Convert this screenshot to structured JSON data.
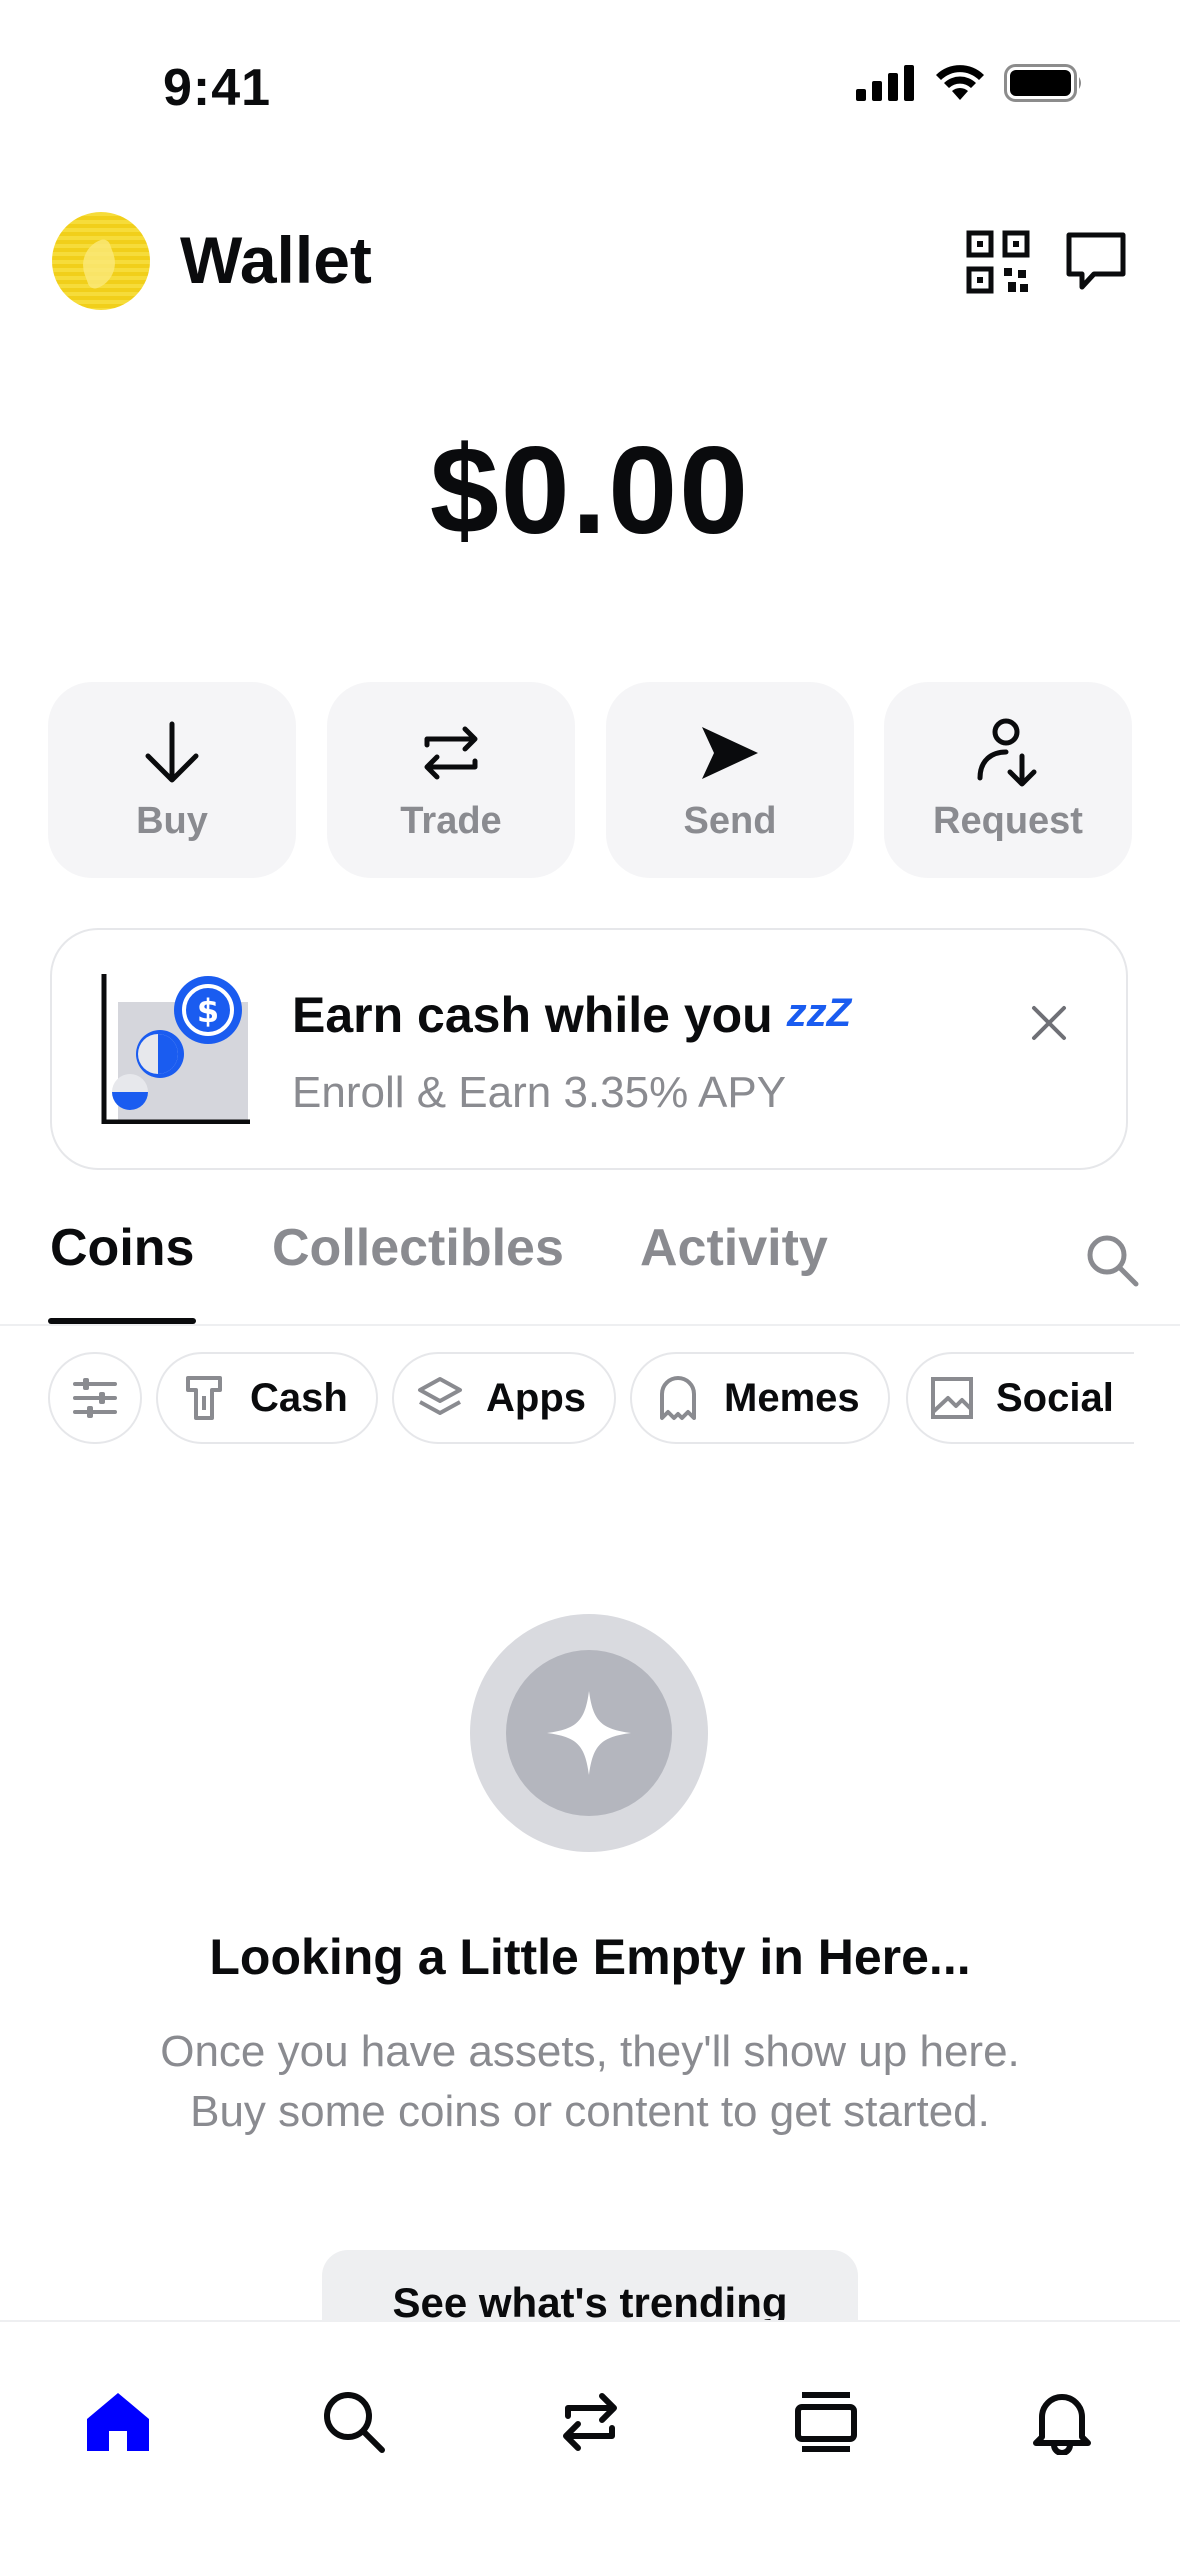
{
  "status_bar": {
    "time": "9:41",
    "icons": [
      "cellular-signal-icon",
      "wifi-icon",
      "battery-icon"
    ]
  },
  "header": {
    "title": "Wallet",
    "icons": [
      "qr-code-icon",
      "message-icon"
    ]
  },
  "balance": "$0.00",
  "actions": [
    {
      "label": "Buy",
      "icon": "arrow-down-icon"
    },
    {
      "label": "Trade",
      "icon": "swap-arrows-icon"
    },
    {
      "label": "Send",
      "icon": "send-icon"
    },
    {
      "label": "Request",
      "icon": "request-user-icon"
    }
  ],
  "promo": {
    "title": "Earn cash while you",
    "zzz": "zzZ",
    "subtitle": "Enroll & Earn 3.35% APY"
  },
  "tabs": [
    {
      "label": "Coins",
      "active": true
    },
    {
      "label": "Collectibles",
      "active": false
    },
    {
      "label": "Activity",
      "active": false
    }
  ],
  "chips": [
    {
      "label": "Cash",
      "icon": "cash-icon"
    },
    {
      "label": "Apps",
      "icon": "layers-icon"
    },
    {
      "label": "Memes",
      "icon": "ghost-icon"
    },
    {
      "label": "Social",
      "icon": "image-icon"
    }
  ],
  "empty_state": {
    "title": "Looking a Little Empty in Here...",
    "body": "Once you have assets, they'll show up here. Buy some coins or content to get started.",
    "button": "See what's trending"
  },
  "bottom_nav": [
    "home-icon",
    "search-icon",
    "trade-icon",
    "browse-icon",
    "notifications-icon"
  ],
  "colors": {
    "accent": "#0000ff",
    "usdc_blue": "#1a5cf0",
    "muted_text": "#8a8b90",
    "card_bg": "#f5f5f7"
  }
}
